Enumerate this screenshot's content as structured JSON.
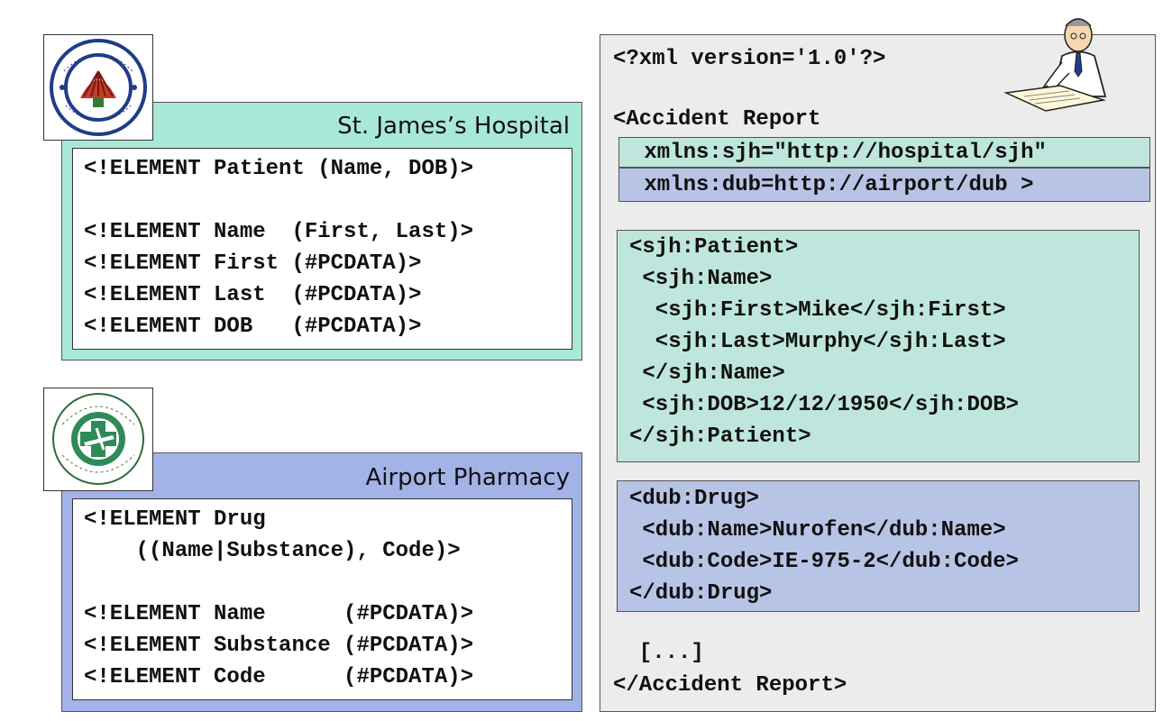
{
  "hospital": {
    "title": "St. James’s Hospital",
    "logo": {
      "icon": "hospital-seal-logo",
      "ring_text": "Ospidéal Naomh Sheamais · Seirbhís Dé agus A Phobail"
    },
    "dtd_lines": [
      "<!ELEMENT Patient (Name, DOB)>",
      "<!ELEMENT Name  (First, Last)>",
      "<!ELEMENT First (#PCDATA)>",
      "<!ELEMENT Last  (#PCDATA)>",
      "<!ELEMENT DOB   (#PCDATA)>"
    ],
    "color": "#a8e8d8"
  },
  "pharmacy": {
    "title": "Airport Pharmacy",
    "logo": {
      "icon": "airport-pharmacy-logo",
      "ring_text": "AIRPORT PHARMACY"
    },
    "dtd_lines": [
      "<!ELEMENT Drug",
      "    ((Name|Substance), Code)>",
      "<!ELEMENT Name      (#PCDATA)>",
      "<!ELEMENT Substance (#PCDATA)>",
      "<!ELEMENT Code      (#PCDATA)>"
    ],
    "color": "#a3b3e8"
  },
  "xml_doc": {
    "declaration": "<?xml version='1.0'?>",
    "root_open": "<Accident Report",
    "ns_sjh": " xmlns:sjh=\"http://hospital/sjh\"",
    "ns_dub": " xmlns:dub=http://airport/dub >",
    "patient_lines": [
      "<sjh:Patient>",
      " <sjh:Name>",
      "  <sjh:First>Mike</sjh:First>",
      "  <sjh:Last>Murphy</sjh:Last>",
      " </sjh:Name>",
      " <sjh:DOB>12/12/1950</sjh:DOB>",
      "</sjh:Patient>"
    ],
    "drug_lines": [
      "<dub:Drug>",
      " <dub:Name>Nurofen</dub:Name>",
      " <dub:Code>IE-975-2</dub:Code>",
      "</dub:Drug>"
    ],
    "ellipsis": "  [...]",
    "root_close": "</Accident Report>",
    "illustration": "doctor-writing-icon",
    "colors": {
      "panel": "#ececec",
      "sjh": "#bfe6dc",
      "dub": "#b8c4e6"
    }
  }
}
